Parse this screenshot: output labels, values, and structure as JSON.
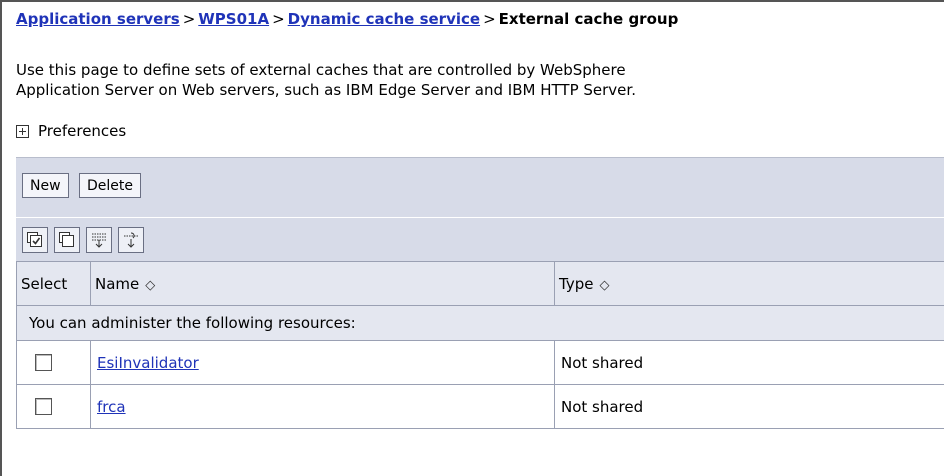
{
  "breadcrumb": {
    "items": [
      "Application servers",
      "WPS01A",
      "Dynamic cache service"
    ],
    "separator": ">",
    "current": "External cache group"
  },
  "description": {
    "line1": "Use this page to define sets of external caches that are controlled by WebSphere",
    "line2": "Application Server on Web servers, such as IBM Edge Server and IBM HTTP Server."
  },
  "preferences": {
    "label": "Preferences"
  },
  "toolbar": {
    "new_label": "New",
    "delete_label": "Delete"
  },
  "icon_toolbar": {
    "icons": [
      "select-all-icon",
      "deselect-all-icon",
      "show-filter-icon",
      "clear-filter-icon"
    ]
  },
  "table": {
    "columns": {
      "select": "Select",
      "name": "Name",
      "type": "Type"
    },
    "sort_glyph": "◇",
    "info_text": "You can administer the following resources:",
    "rows": [
      {
        "name": "EsiInvalidator",
        "type": "Not shared"
      },
      {
        "name": "frca",
        "type": "Not shared"
      }
    ]
  },
  "colors": {
    "link": "#1f33b8",
    "toolbar_bg": "#d7dbe8",
    "header_bg": "#e4e7f0"
  }
}
